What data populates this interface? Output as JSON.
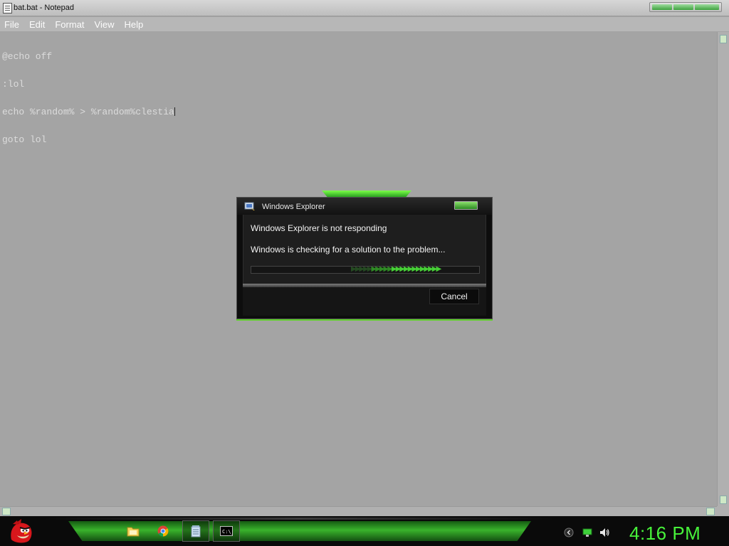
{
  "notepad": {
    "title": "bat.bat - Notepad",
    "menu": [
      "File",
      "Edit",
      "Format",
      "View",
      "Help"
    ],
    "lines": [
      "@echo off",
      ":lol",
      "echo %random% > %random%clestia",
      "goto lol"
    ]
  },
  "dialog": {
    "title": "Windows Explorer",
    "message": "Windows Explorer is not responding",
    "status": "Windows is checking for a solution to the problem...",
    "cancel_label": "Cancel"
  },
  "taskbar": {
    "pinned": [
      {
        "name": "folder-icon"
      },
      {
        "name": "chrome-icon"
      },
      {
        "name": "notepad-icon"
      },
      {
        "name": "cmd-icon",
        "label": "C:\\_"
      }
    ],
    "tray": [
      "chevron-icon",
      "network-icon",
      "volume-icon"
    ],
    "clock": "4:16 PM"
  },
  "colors": {
    "accent": "#47f23a",
    "progress": "#3ec42e",
    "editor_bg": "#a4a4a4"
  }
}
